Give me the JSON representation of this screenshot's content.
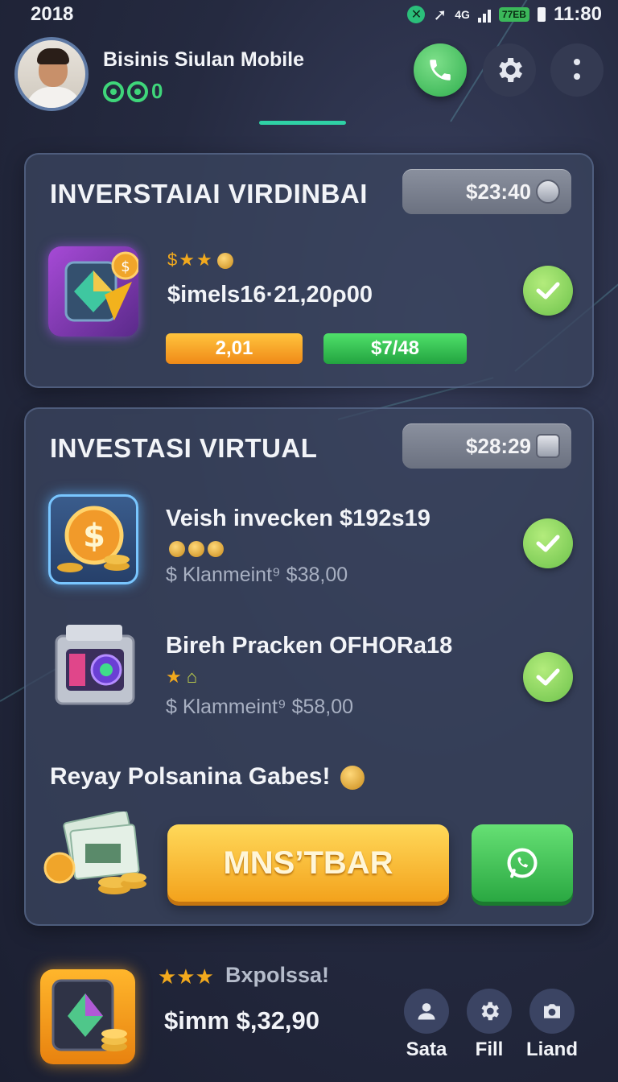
{
  "status_bar": {
    "left_text": "2018",
    "network": "4G",
    "battery": "77EB",
    "time": "11:80"
  },
  "header": {
    "title": "Bisinis Siulan Mobile",
    "status_value": "0"
  },
  "card1": {
    "title": "INVERSTAIAI VIRDINBAI",
    "pill_value": "$23:40",
    "value": "$imels16·21,20ρ00",
    "orange_btn": "2,01",
    "green_btn": "$7/48"
  },
  "card2": {
    "title": "INVESTASI VIRTUAL",
    "pill_value": "$28:29",
    "items": [
      {
        "title": "Veish invecken $192ѕ19",
        "sub": "$ Klаnmeint⁹ $38,00"
      },
      {
        "title": "Bireh Pracken OFHORa18",
        "sub": "$ Klammeint⁹ $58,00"
      }
    ],
    "promo": "Reyay Polsanina Gabes!",
    "cta_label": "MNS’TBAR"
  },
  "bottom": {
    "tag": "Bxpolssa!",
    "value": "$imm $,32,90",
    "nav": [
      {
        "label": "Sata"
      },
      {
        "label": "Fill"
      },
      {
        "label": "Liand"
      }
    ]
  },
  "colors": {
    "accent_green": "#2fae4e",
    "accent_orange": "#f08a18",
    "teal_tab": "#2fd1a5",
    "card_bg": "#3a445e"
  },
  "icons": [
    "phone-icon",
    "gear-icon",
    "more-vertical-icon",
    "check-icon",
    "whatsapp-icon",
    "user-icon",
    "settings-icon",
    "camera-icon"
  ]
}
